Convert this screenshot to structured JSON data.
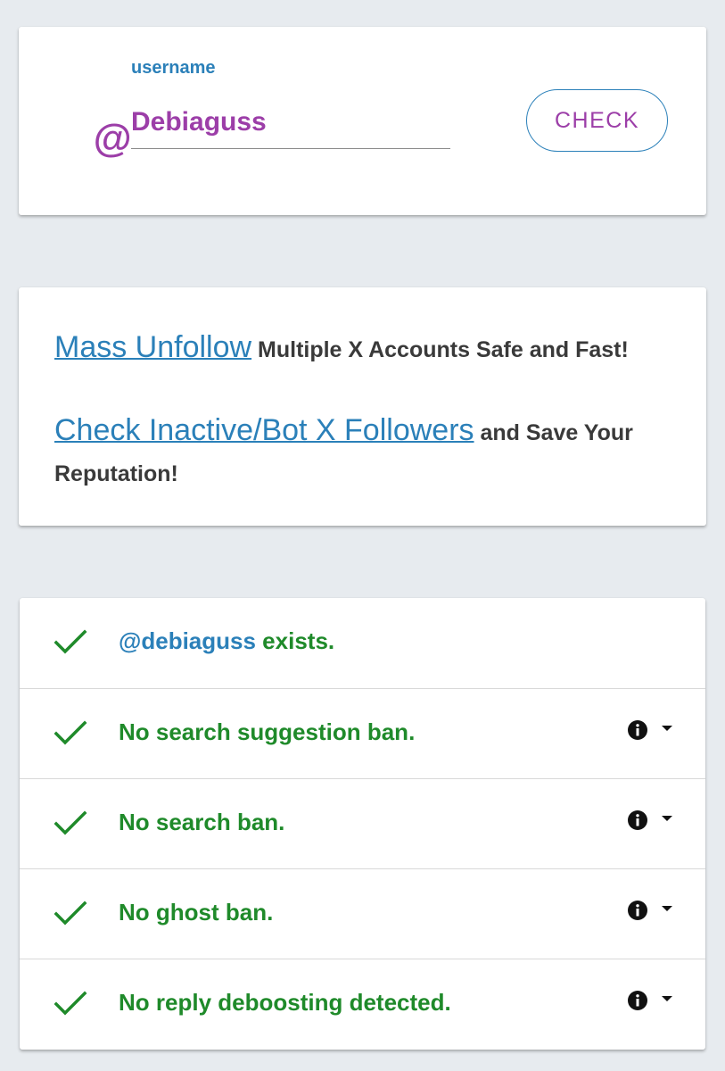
{
  "search": {
    "at_symbol": "@",
    "label": "username",
    "value": "Debiaguss",
    "button_label": "CHECK"
  },
  "promo": {
    "line1_link": "Mass Unfollow",
    "line1_text": " Multiple X Accounts Safe and Fast!",
    "line2_link": "Check Inactive/Bot X Followers",
    "line2_text": " and Save Your Reputation!"
  },
  "results": {
    "exists": {
      "user": "@debiaguss",
      "text": " exists."
    },
    "items": [
      {
        "text": "No search suggestion ban."
      },
      {
        "text": "No search ban."
      },
      {
        "text": "No ghost ban."
      },
      {
        "text": "No reply deboosting detected."
      }
    ]
  },
  "colors": {
    "accent_purple": "#9c3ea8",
    "accent_blue": "#2b80b9",
    "success_green": "#1f8a2a",
    "background": "#e7ebef"
  },
  "icons": {
    "status": "checkmark-icon",
    "info": "info-icon",
    "expand": "caret-down-icon"
  }
}
